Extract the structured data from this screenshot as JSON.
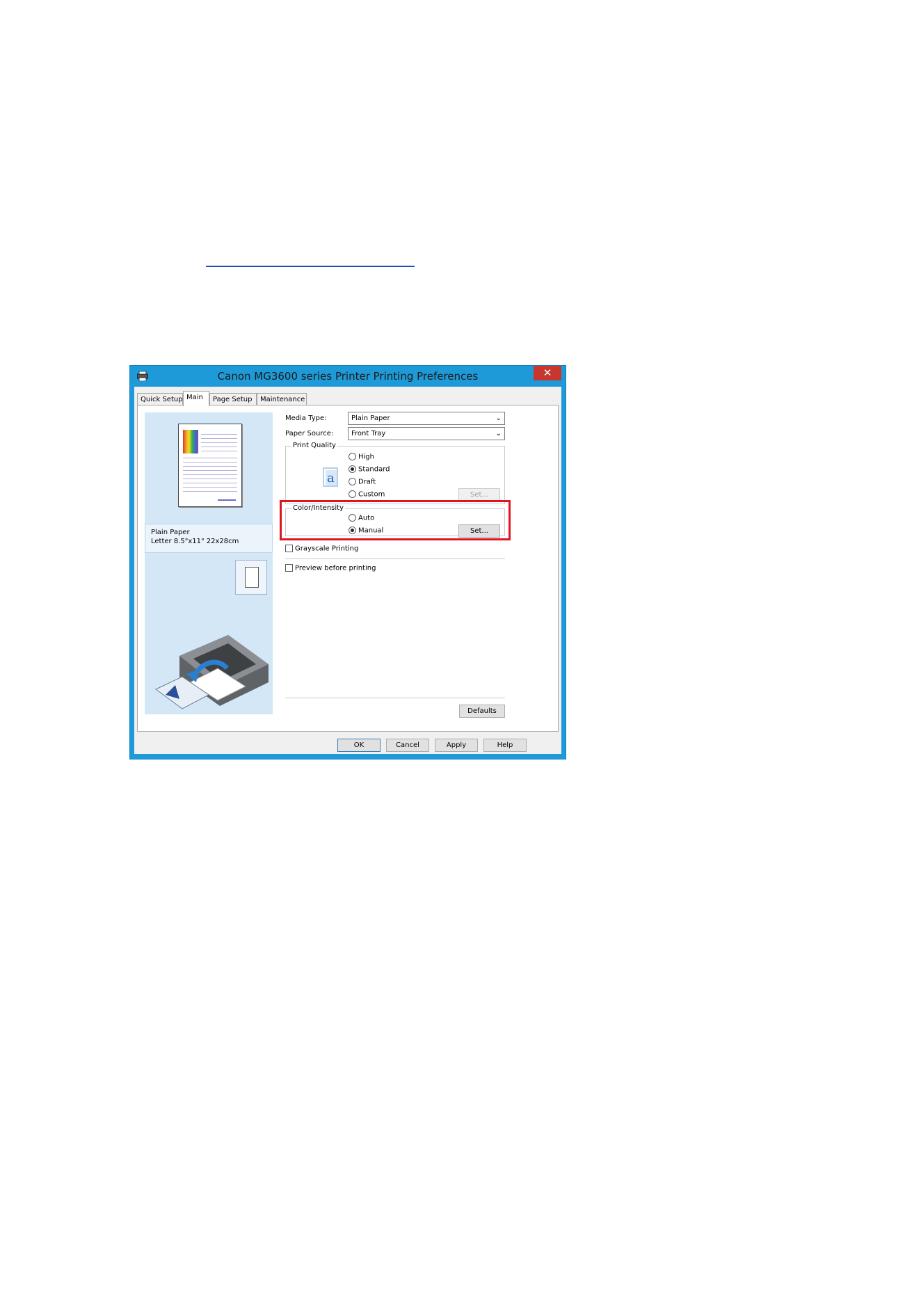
{
  "doc": {
    "link_text": ""
  },
  "window": {
    "title": "Canon MG3600 series Printer Printing Preferences",
    "close_label": "✕"
  },
  "tabs": [
    {
      "label": "Quick Setup"
    },
    {
      "label": "Main"
    },
    {
      "label": "Page Setup"
    },
    {
      "label": "Maintenance"
    }
  ],
  "left_panel": {
    "paper_info_line1": "Plain Paper",
    "paper_info_line2": "Letter 8.5\"x11\" 22x28cm"
  },
  "media_type": {
    "label": "Media Type:",
    "value": "Plain Paper"
  },
  "paper_source": {
    "label": "Paper Source:",
    "value": "Front Tray"
  },
  "print_quality": {
    "title": "Print Quality",
    "options": [
      {
        "label": "High",
        "selected": false
      },
      {
        "label": "Standard",
        "selected": true
      },
      {
        "label": "Draft",
        "selected": false
      },
      {
        "label": "Custom",
        "selected": false
      }
    ],
    "set_label": "Set..."
  },
  "color_intensity": {
    "title": "Color/Intensity",
    "options": [
      {
        "label": "Auto",
        "selected": false
      },
      {
        "label": "Manual",
        "selected": true
      }
    ],
    "set_label": "Set..."
  },
  "grayscale": {
    "label": "Grayscale Printing",
    "checked": false
  },
  "preview": {
    "label": "Preview before printing",
    "checked": false
  },
  "buttons": {
    "defaults": "Defaults",
    "ok": "OK",
    "cancel": "Cancel",
    "apply": "Apply",
    "help": "Help"
  },
  "colors": {
    "title_bar": "#1e9ad8",
    "close_button": "#c7372d",
    "highlight": "#e0141e",
    "preview_panel": "#d3e7f7"
  }
}
